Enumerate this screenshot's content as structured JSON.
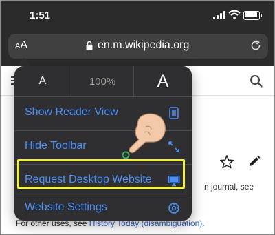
{
  "status_bar": {
    "time": "1:51"
  },
  "address_bar": {
    "aa_small": "A",
    "aa_large": "A",
    "url": "en.m.wikipedia.org"
  },
  "page": {
    "text_line1": "n journal, see",
    "text_line2": "",
    "other_uses_prefix": "For other uses, see ",
    "other_uses_link": "History Today (disambiguation)",
    "other_uses_suffix": "."
  },
  "menu": {
    "zoom_decrease": "A",
    "zoom_level": "100%",
    "zoom_increase": "A",
    "items": [
      {
        "label": "Show Reader View",
        "icon": "reader-view-icon"
      },
      {
        "label": "Hide Toolbar",
        "icon": "expand-arrows-icon"
      },
      {
        "label": "Request Desktop Website",
        "icon": "desktop-monitor-icon"
      },
      {
        "label": "Website Settings",
        "icon": "settings-gear-icon"
      }
    ]
  },
  "colors": {
    "menu_bg": "#2f2f31",
    "accent": "#4d8ff7",
    "highlight": "#f2f13f"
  }
}
